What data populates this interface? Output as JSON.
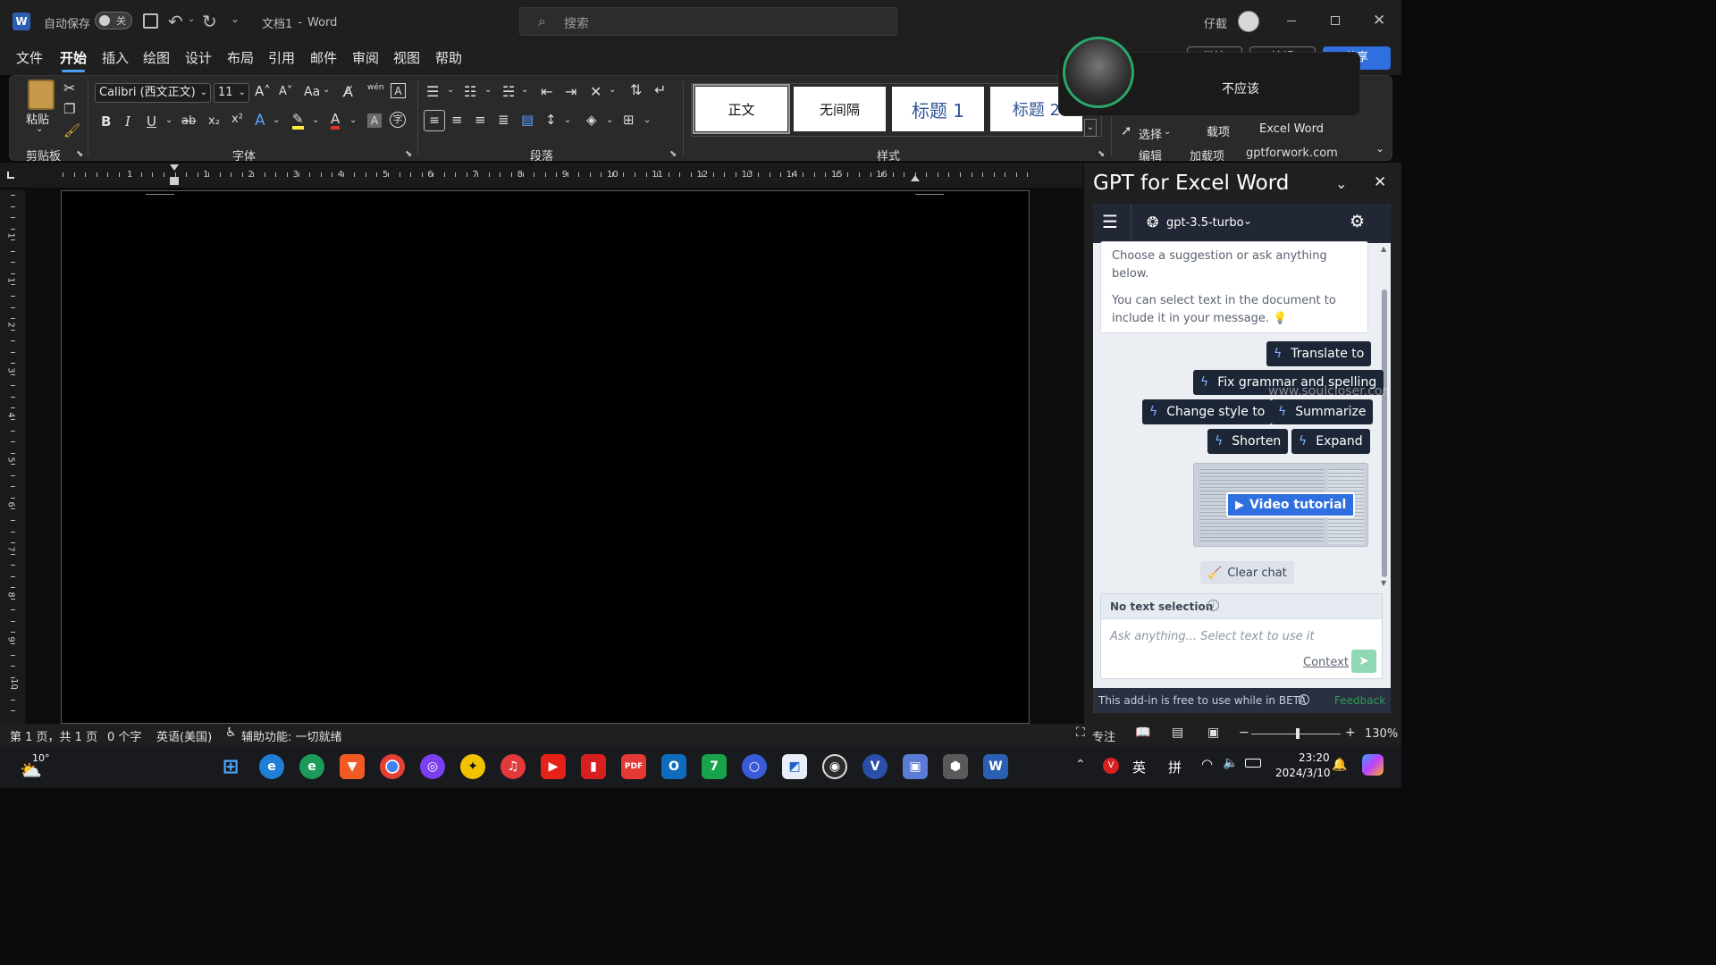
{
  "titlebar": {
    "autosave_label": "自动保存",
    "autosave_state": "关",
    "doc_title": "文档1",
    "separator": "-",
    "app_name": "Word",
    "search_placeholder": "搜索",
    "user_name": "仔截"
  },
  "menu": {
    "tabs": [
      "文件",
      "开始",
      "插入",
      "绘图",
      "设计",
      "布局",
      "引用",
      "邮件",
      "审阅",
      "视图",
      "帮助"
    ],
    "active_index": 1,
    "right_buttons": [
      "批注",
      "编辑",
      "共享"
    ]
  },
  "ribbon": {
    "clipboard": {
      "paste_label": "粘贴",
      "group_label": "剪贴板"
    },
    "font": {
      "font_name": "Calibri (西文正文)",
      "font_size": "11",
      "group_label": "字体",
      "case_label": "Aa",
      "pinyin_label": "wén"
    },
    "paragraph": {
      "group_label": "段落"
    },
    "styles": {
      "items": [
        "正文",
        "无间隔",
        "标题 1",
        "标题 2"
      ],
      "group_label": "样式"
    },
    "editing": {
      "select_label": "选择",
      "group_label": "编辑"
    },
    "addins": {
      "label_top": "载项",
      "group_label": "加载项"
    },
    "gpt": {
      "label": "Excel Word",
      "group_label": "gptforwork.com"
    }
  },
  "ruler": {
    "numbers": [
      "1",
      "1",
      "2",
      "3",
      "4",
      "5",
      "6",
      "7",
      "8",
      "9",
      "10",
      "11",
      "12",
      "13",
      "14",
      "15",
      "16"
    ],
    "vnumbers": [
      "1",
      "1",
      "2",
      "3",
      "4",
      "5",
      "6",
      "7",
      "8",
      "9",
      "10",
      "11"
    ]
  },
  "notification": {
    "text": "不应该"
  },
  "pane": {
    "title": "GPT for Excel Word",
    "model": "gpt-3.5-turbo",
    "intro_line1": "Choose a suggestion or ask anything below.",
    "intro_line2": "You can select text in the document to include it in your message. 💡",
    "chips": [
      "Translate to",
      "Fix grammar and spelling",
      "Change style to",
      "Summarize",
      "Shorten",
      "Expand"
    ],
    "video_label": "Video tutorial",
    "clear_chat": "Clear chat",
    "selection_status": "No text selection",
    "input_placeholder": "Ask anything... Select text to use it",
    "context_label": "Context",
    "footer_text": "This add-in is free to use while in BETA",
    "feedback": "Feedback",
    "watermark": "www.soulcloser.com"
  },
  "statusbar": {
    "page_info": "第 1 页，共 1 页",
    "word_count": "0 个字",
    "language": "英语(美国)",
    "accessibility": "辅助功能: 一切就绪",
    "focus": "专注",
    "zoom": "130%"
  },
  "taskbar": {
    "weather_temp": "10°",
    "ime_lang": "英",
    "ime_mode": "拼",
    "time": "23:20",
    "date": "2024/3/10"
  },
  "colors": {
    "accent": "#4a9df0",
    "share_button": "#2f6fe0",
    "addin_header": "#212735",
    "chip_bg": "#1d2636",
    "heading_blue": "#2f5597",
    "feedback_green": "#2f9a55"
  }
}
